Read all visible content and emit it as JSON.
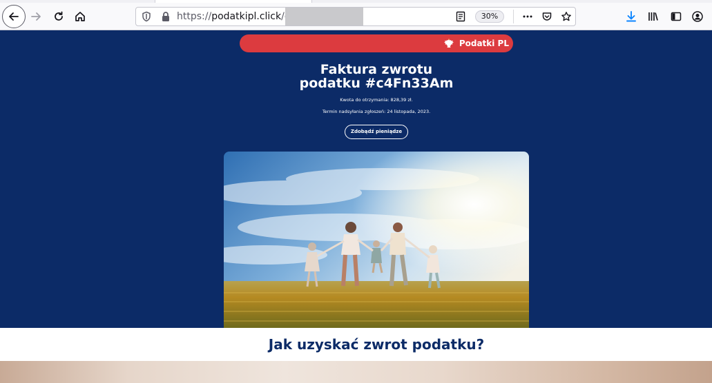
{
  "browser": {
    "url_prefix": "https://",
    "url_host": "podatkipl.click",
    "url_path": "/c",
    "zoom": "30%"
  },
  "banner": {
    "brand": "Podatki PL",
    "color": "#dc3b3f"
  },
  "hero": {
    "background": "#0c2b67",
    "title_line1": "Faktura zwrotu",
    "title_line2": "podatku #c4Fn33Am",
    "amount_text": "Kwota do otrzymania: 828,39 zł.",
    "deadline_text": "Termin nadsyłania zgłoszeń: 24 listopada, 2023.",
    "cta_label": "Zdobądź pieniądze"
  },
  "section": {
    "heading": "Jak uzyskać zwrot podatku?"
  },
  "icons": [
    "back-icon",
    "forward-icon",
    "reload-icon",
    "home-icon",
    "shield-icon",
    "lock-icon",
    "reader-icon",
    "more-icon",
    "pocket-icon",
    "star-icon",
    "download-icon",
    "library-icon",
    "sidebar-icon",
    "account-icon",
    "eagle-icon"
  ]
}
